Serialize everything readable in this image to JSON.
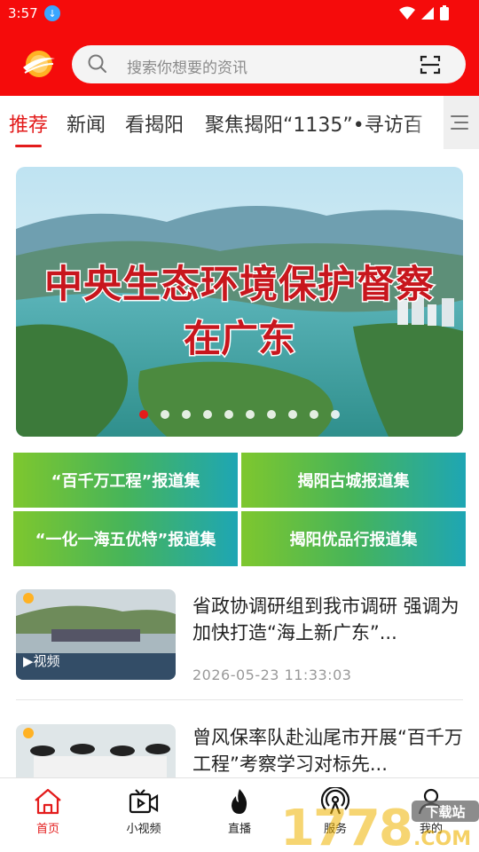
{
  "status_bar": {
    "time": "3:57"
  },
  "search": {
    "placeholder": "搜索你想要的资讯"
  },
  "tabs": [
    {
      "label": "推荐"
    },
    {
      "label": "新闻"
    },
    {
      "label": "看揭阳"
    },
    {
      "label": "聚焦揭阳“1135”•寻访百"
    }
  ],
  "banner": {
    "title_line1": "中央生态环境保护督察",
    "title_line2": "在广东",
    "slide_count": 10,
    "active_slide": 1
  },
  "topics": [
    {
      "label": "“百千万工程”报道集"
    },
    {
      "label": "揭阳古城报道集"
    },
    {
      "label": "“一化一海五优特”报道集"
    },
    {
      "label": "揭阳优品行报道集"
    }
  ],
  "news": [
    {
      "headline": "省政协调研组到我市调研 强调为加快打造“海上新广东”...",
      "date": "2026-05-23  11:33:03",
      "badge": "视频"
    },
    {
      "headline": "曾风保率队赴汕尾市开展“百千万工程”考察学习对标先...",
      "date": ""
    }
  ],
  "bottom_nav": [
    {
      "label": "首页",
      "icon": "home-icon"
    },
    {
      "label": "小视频",
      "icon": "video-icon"
    },
    {
      "label": "直播",
      "icon": "flame-icon"
    },
    {
      "label": "服务",
      "icon": "broadcast-icon"
    },
    {
      "label": "我的",
      "icon": "user-icon"
    }
  ],
  "watermark": {
    "text": "1778",
    "suffix": "下载站",
    "com": ".COM"
  },
  "colors": {
    "brand_red": "#f50b0b",
    "accent_red": "#e31b1b",
    "topic_green": "#7ec72e",
    "topic_teal": "#1ea6b4"
  }
}
